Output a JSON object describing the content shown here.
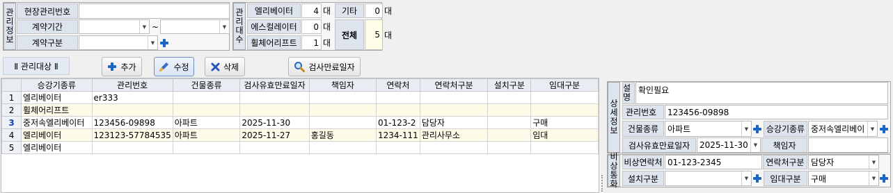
{
  "mgmt_info": {
    "section_label": "관리정보",
    "site_no_label": "현장관리번호",
    "site_no_value": "",
    "contract_period_label": "계약기간",
    "contract_from": "",
    "tilde": "~",
    "contract_to": "",
    "contract_type_label": "계약구분",
    "contract_type_value": ""
  },
  "mgmt_counts": {
    "section_label": "관리대수",
    "unit": "대",
    "elevator_label": "엘리베이터",
    "elevator_count": "4",
    "escalator_label": "에스컬레이터",
    "escalator_count": "0",
    "wheelchair_label": "휠체어리프트",
    "wheelchair_count": "1",
    "other_label": "기타",
    "other_count": "0",
    "total_label": "전체",
    "total_count": "5"
  },
  "toolbar": {
    "tab_label": "Ⅱ 관리대상 Ⅱ",
    "add_label": "추가",
    "edit_label": "수정",
    "delete_label": "삭제",
    "inspection_label": "검사만료일자"
  },
  "grid": {
    "columns": [
      "승강기종류",
      "관리번호",
      "건물종류",
      "검사유효만료일자",
      "책임자",
      "연락처",
      "연락처구분",
      "설치구분",
      "임대구분"
    ],
    "rows": [
      {
        "no": "1",
        "cells": [
          "엘리베이터",
          "er333",
          "",
          "",
          "",
          "",
          "",
          "",
          ""
        ]
      },
      {
        "no": "2",
        "cells": [
          "휠체어리프트",
          "",
          "",
          "",
          "",
          "",
          "",
          "",
          ""
        ]
      },
      {
        "no": "3",
        "cells": [
          "중저속엘리베이터",
          "123456-09898",
          "아파트",
          "2025-11-30",
          "",
          "01-123-2",
          "담당자",
          "",
          "구매"
        ]
      },
      {
        "no": "4",
        "cells": [
          "엘리베이터",
          "123123-57784535",
          "아파트",
          "2025-11-27",
          "홍길동",
          "1234-111",
          "관리사무소",
          "",
          "임대"
        ]
      },
      {
        "no": "5",
        "cells": [
          "엘리베이터",
          "",
          "",
          "",
          "",
          "",
          "",
          "",
          ""
        ]
      }
    ]
  },
  "detail": {
    "section_label": "상세정보",
    "desc_label": "설명",
    "desc_value": "확인필요",
    "mgmt_no_label": "관리번호",
    "mgmt_no_value": "123456-09898",
    "building_label": "건물종류",
    "building_value": "아파트",
    "elev_type_label": "승강기종류",
    "elev_type_value": "중저속엘리베이",
    "insp_label": "검사유효만료일자",
    "insp_value": "2025-11-30",
    "manager_label": "책임자",
    "manager_value": ""
  },
  "emergency": {
    "section_label": "비상통화",
    "contact_label": "비상연락처",
    "contact_value": "01-123-2345",
    "contact_type_label": "연락처구분",
    "contact_type_value": "담당자",
    "install_label": "설치구분",
    "install_value": "",
    "lease_label": "임대구분",
    "lease_value": "구매"
  }
}
